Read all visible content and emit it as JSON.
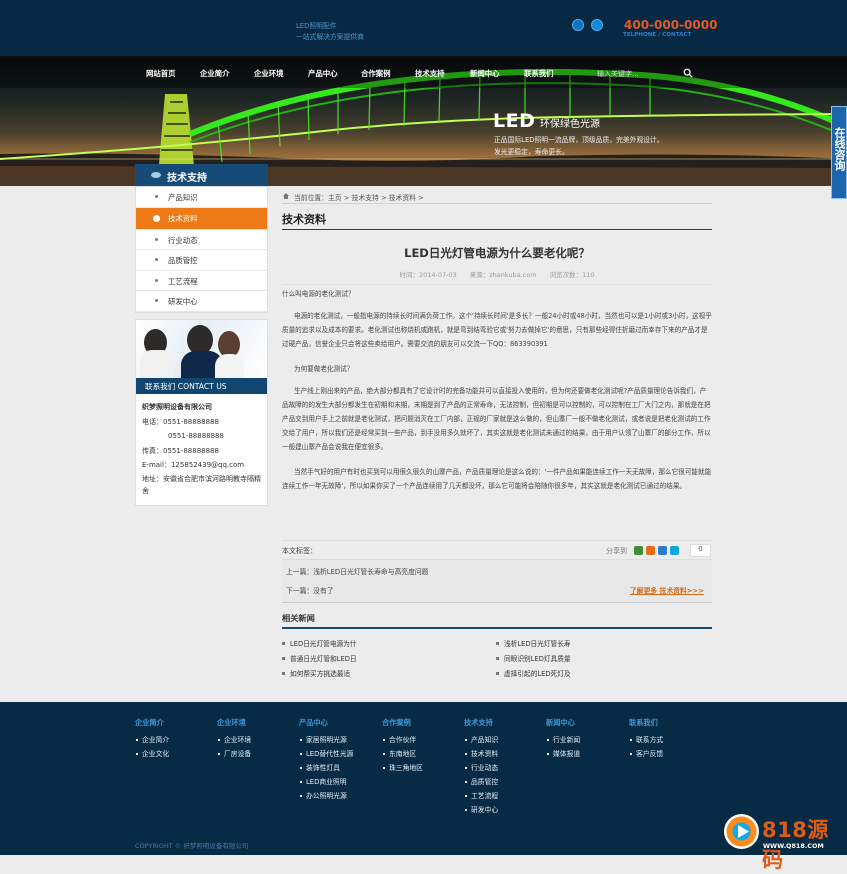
{
  "header": {
    "slogan_line1": "LED照明配件",
    "slogan_line2": "一站式解决方案提供商",
    "phone": "400-000-0000",
    "phone_label": "TELPHONE / CONTACT"
  },
  "nav": {
    "items": [
      "网站首页",
      "企业简介",
      "企业环境",
      "产品中心",
      "合作案例",
      "技术支持",
      "新闻中心",
      "联系我们"
    ],
    "search_placeholder": "输入关键字..."
  },
  "banner": {
    "title": "LED",
    "subtitle": "环保绿色光源",
    "line": "正品国际LED照明一流品牌，顶级品质，完美外观设计。\n发光更稳定，寿命更长。"
  },
  "online_service": "在线咨询",
  "sidebar": {
    "title": "技术支持",
    "items": [
      "产品知识",
      "技术资料",
      "行业动态",
      "品质管控",
      "工艺流程",
      "研发中心"
    ],
    "active_index": 1
  },
  "contact": {
    "bar": "联系我们 CONTACT US",
    "company": "织梦照明设备有限公司",
    "phone_label": "电话：",
    "phone1": "0551-88888888",
    "phone2": "0551-88888888",
    "fax_label": "传真：",
    "fax": "0551-88888888",
    "email_label": "E-mail：",
    "email": "125852439@qq.com",
    "address_label": "地址：",
    "address": "安徽省合肥市滨河路明教寺隔精舍"
  },
  "breadcrumb": "当前位置：主页 > 技术支持 > 技术资料 >",
  "main": {
    "section_title": "技术资料",
    "article_title": "LED日光灯管电源为什么要老化呢？",
    "meta": "时间：2014-07-03　　来源：zhankuba.com　　浏览次数：110",
    "p1": "什么叫电源的老化测试？",
    "p2": "电源的老化测试，一般指电源的持续长时间满负荷工作。这个'持续长时间'是多长？一般24小时或48小时，当然也可以是1小时或3小时，这视乎质量的追求以及成本的要求。老化测试也称烧机或跑机，就是弯到结弯验它或'努力去做掉它'的意思，只有那些经得住折磨过而幸存下来的产品才是过硬产品，信誉企业只会将这些卖给用户。需要交流的朋友可以交流一下QQ：863390391",
    "p3": "为何要做老化测试？",
    "p4": "生产线上刚出来的产品，绝大部分都具有了它设计时的完备功能并可以直接投入使用的，但为何还要做老化测试呢?产品质量理论告诉我们，产品故障的的发生大部分都发生在初期和末期，末期是到了产品的正常寿命，无法控制，但初期是可以控制的，可以控制在工厂大门之内，那就是在把产品交到用户手上之前就是老化测试，把问题消灭在工厂内部，正规的厂家就是这么做的，但山寨厂一般不做老化测试，或者说是把老化测试的工作交给了用户，所以我们还是经常买到一些产品，到手没用多久就坏了，其实这就是老化测试未通过的结果，由于用户认领了山寨厂的部分工作，所以一般建山寨产品会说我在便宜很多。",
    "p5": "当然手气好的用户有时也买到可以用很久很久的山寨产品，产品质量理论是这么说的：'一件产品如果能连续工作一天无故障，那么它很可能就能连续工作一年无故障'，所以如果你买了一个产品连续用了几天都没坏，那么它可能将会陪随你很多年，其实这就是老化测试已通过的结果。",
    "tags_label": "本文标签：",
    "share_label": "分享到",
    "share_count": "0",
    "prev": "上一篇：浅析LED日光灯管长寿命与高亮度问题",
    "next": "下一篇：没有了",
    "more": "了解更多 技术资料>>>",
    "related_title": "相关新闻",
    "related": [
      "LED日光灯管电源为什",
      "浅析LED日光灯管长寿",
      "普通日光灯管和LED日",
      "同眼识别LED灯具质量",
      "如何帮买方挑选最适",
      "虚择引起的LED死灯及"
    ]
  },
  "footer": {
    "columns": [
      {
        "title": "企业简介",
        "items": [
          "企业简介",
          "企业文化"
        ]
      },
      {
        "title": "企业环境",
        "items": [
          "企业环境",
          "厂房设备"
        ]
      },
      {
        "title": "产品中心",
        "items": [
          "家居照明光源",
          "LED替代性光源",
          "装饰性灯具",
          "LED商业照明",
          "办公照明光源"
        ]
      },
      {
        "title": "合作案例",
        "items": [
          "合作伙伴",
          "东南地区",
          "珠三角地区"
        ]
      },
      {
        "title": "技术支持",
        "items": [
          "产品知识",
          "技术资料",
          "行业动态",
          "品质管控",
          "工艺流程",
          "研发中心"
        ]
      },
      {
        "title": "新闻中心",
        "items": [
          "行业新闻",
          "媒体报道"
        ]
      },
      {
        "title": "联系我们",
        "items": [
          "联系方式",
          "客户反馈"
        ]
      }
    ],
    "copyright": "COPYRIGHT © 织梦照明设备有限公司"
  },
  "watermark": {
    "text": "818源码",
    "url": "WWW.Q818.COM"
  },
  "colors": {
    "navy": "#072944",
    "blue": "#164b77",
    "orange": "#ed7a16",
    "phone": "#e35b26",
    "green": "#35e81b"
  }
}
